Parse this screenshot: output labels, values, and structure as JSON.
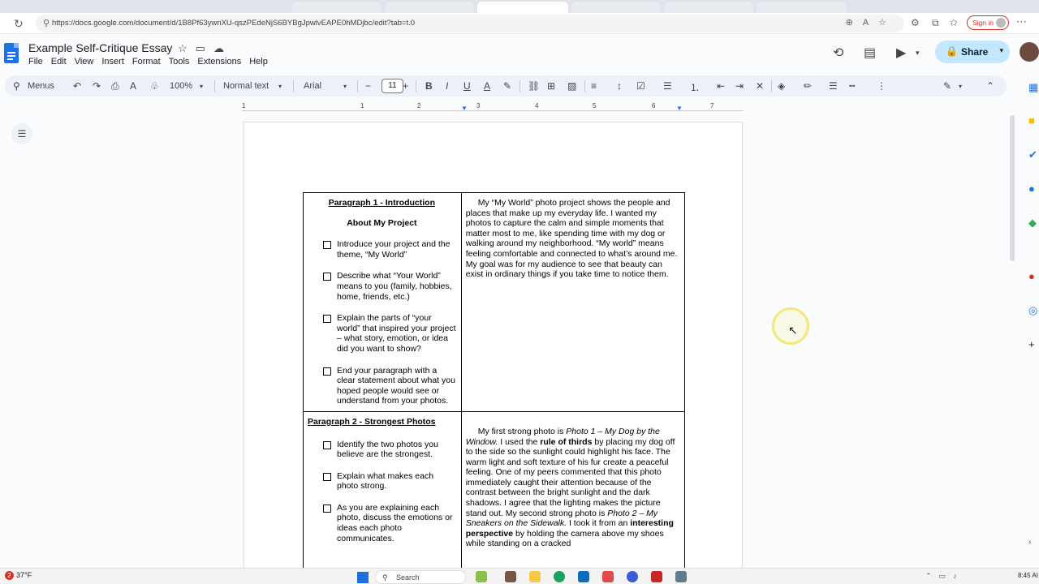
{
  "browser": {
    "url": "https://docs.google.com/document/d/1B8Pf63ywnXU-qszPEdeNjS6BYBgJpwlvEAPE0hMDjbc/edit?tab=t.0",
    "signin_label": "Sign in"
  },
  "docs": {
    "title": "Example Self-Critique Essay",
    "menu": [
      "File",
      "Edit",
      "View",
      "Insert",
      "Format",
      "Tools",
      "Extensions",
      "Help"
    ],
    "share_label": "Share"
  },
  "toolbar": {
    "menus_label": "Menus",
    "zoom": "100%",
    "style": "Normal text",
    "font": "Arial",
    "font_size": "11"
  },
  "ruler": {
    "numbers": [
      "1",
      "1",
      "2",
      "3",
      "4",
      "5",
      "6",
      "7"
    ]
  },
  "table": {
    "rows": [
      {
        "heading": "Paragraph 1 - Introduction",
        "subheading": "About My Project",
        "checklist": [
          "Introduce your project and the theme, “My World”",
          "Describe what “Your World” means to you (family, hobbies, home, friends, etc.)",
          "Explain the parts of “your world” that inspired your project – what story, emotion, or idea did you want to show?",
          "End your paragraph with a clear statement about what you hoped people would see or understand from your photos."
        ],
        "response": "My “My World” photo project shows the people and places that make up my everyday life. I wanted my photos to capture the calm and simple moments that matter most to me, like spending time with my dog or walking around my neighborhood. “My world” means feeling comfortable and connected to what’s around me. My goal was for my audience to see that beauty can exist in ordinary things if you take time to notice them."
      },
      {
        "heading": "Paragraph 2 - Strongest Photos",
        "checklist": [
          "Identify the two photos you believe are the strongest.",
          "Explain what makes each photo strong.",
          "As you are explaining each photo, discuss the emotions or ideas each photo communicates."
        ],
        "response_parts": {
          "p1": "My first strong photo is ",
          "photo1": "Photo 1 – My Dog by the Window.",
          "p2": " I used the ",
          "rule": "rule of thirds",
          "p3": " by placing my dog off to the side so the sunlight could highlight his face. The warm light and soft texture of his fur create a peaceful feeling. One of my peers commented that this photo immediately caught their attention because of the contrast between the bright sunlight and the dark shadows. I agree that the lighting makes the picture stand out. My second strong photo is ",
          "photo2": "Photo 2 – My Sneakers on the Sidewalk.",
          "p4": " I took it from an ",
          "perspective": "interesting perspective",
          "p5": " by holding the camera above my shoes while standing on a cracked"
        }
      }
    ]
  },
  "taskbar": {
    "weather": "37°F",
    "weather_badge": "2",
    "search": "Search",
    "time": "8:45 AI"
  }
}
